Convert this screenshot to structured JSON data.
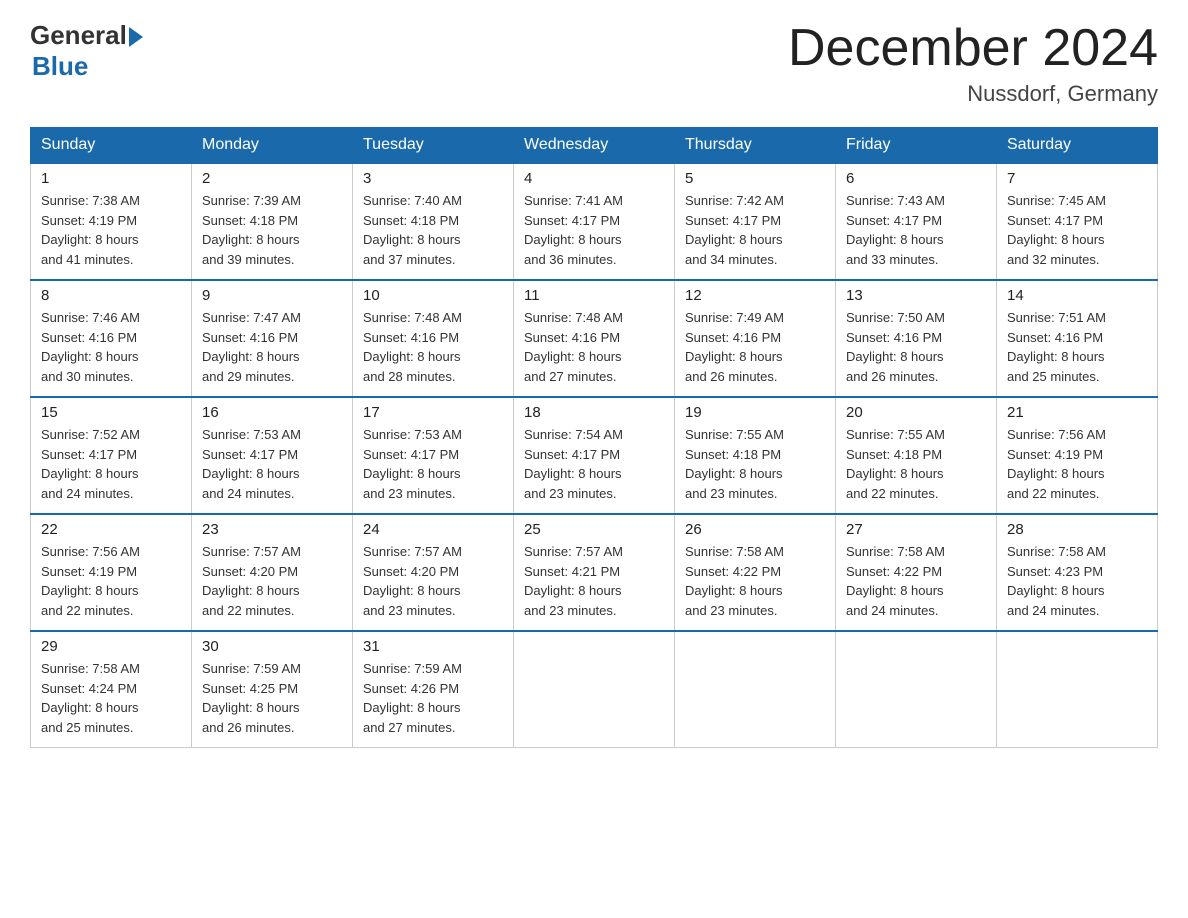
{
  "logo": {
    "general": "General",
    "blue": "Blue"
  },
  "title": {
    "month_year": "December 2024",
    "location": "Nussdorf, Germany"
  },
  "days_of_week": [
    "Sunday",
    "Monday",
    "Tuesday",
    "Wednesday",
    "Thursday",
    "Friday",
    "Saturday"
  ],
  "weeks": [
    [
      {
        "day": "1",
        "sunrise": "7:38 AM",
        "sunset": "4:19 PM",
        "daylight": "8 hours and 41 minutes."
      },
      {
        "day": "2",
        "sunrise": "7:39 AM",
        "sunset": "4:18 PM",
        "daylight": "8 hours and 39 minutes."
      },
      {
        "day": "3",
        "sunrise": "7:40 AM",
        "sunset": "4:18 PM",
        "daylight": "8 hours and 37 minutes."
      },
      {
        "day": "4",
        "sunrise": "7:41 AM",
        "sunset": "4:17 PM",
        "daylight": "8 hours and 36 minutes."
      },
      {
        "day": "5",
        "sunrise": "7:42 AM",
        "sunset": "4:17 PM",
        "daylight": "8 hours and 34 minutes."
      },
      {
        "day": "6",
        "sunrise": "7:43 AM",
        "sunset": "4:17 PM",
        "daylight": "8 hours and 33 minutes."
      },
      {
        "day": "7",
        "sunrise": "7:45 AM",
        "sunset": "4:17 PM",
        "daylight": "8 hours and 32 minutes."
      }
    ],
    [
      {
        "day": "8",
        "sunrise": "7:46 AM",
        "sunset": "4:16 PM",
        "daylight": "8 hours and 30 minutes."
      },
      {
        "day": "9",
        "sunrise": "7:47 AM",
        "sunset": "4:16 PM",
        "daylight": "8 hours and 29 minutes."
      },
      {
        "day": "10",
        "sunrise": "7:48 AM",
        "sunset": "4:16 PM",
        "daylight": "8 hours and 28 minutes."
      },
      {
        "day": "11",
        "sunrise": "7:48 AM",
        "sunset": "4:16 PM",
        "daylight": "8 hours and 27 minutes."
      },
      {
        "day": "12",
        "sunrise": "7:49 AM",
        "sunset": "4:16 PM",
        "daylight": "8 hours and 26 minutes."
      },
      {
        "day": "13",
        "sunrise": "7:50 AM",
        "sunset": "4:16 PM",
        "daylight": "8 hours and 26 minutes."
      },
      {
        "day": "14",
        "sunrise": "7:51 AM",
        "sunset": "4:16 PM",
        "daylight": "8 hours and 25 minutes."
      }
    ],
    [
      {
        "day": "15",
        "sunrise": "7:52 AM",
        "sunset": "4:17 PM",
        "daylight": "8 hours and 24 minutes."
      },
      {
        "day": "16",
        "sunrise": "7:53 AM",
        "sunset": "4:17 PM",
        "daylight": "8 hours and 24 minutes."
      },
      {
        "day": "17",
        "sunrise": "7:53 AM",
        "sunset": "4:17 PM",
        "daylight": "8 hours and 23 minutes."
      },
      {
        "day": "18",
        "sunrise": "7:54 AM",
        "sunset": "4:17 PM",
        "daylight": "8 hours and 23 minutes."
      },
      {
        "day": "19",
        "sunrise": "7:55 AM",
        "sunset": "4:18 PM",
        "daylight": "8 hours and 23 minutes."
      },
      {
        "day": "20",
        "sunrise": "7:55 AM",
        "sunset": "4:18 PM",
        "daylight": "8 hours and 22 minutes."
      },
      {
        "day": "21",
        "sunrise": "7:56 AM",
        "sunset": "4:19 PM",
        "daylight": "8 hours and 22 minutes."
      }
    ],
    [
      {
        "day": "22",
        "sunrise": "7:56 AM",
        "sunset": "4:19 PM",
        "daylight": "8 hours and 22 minutes."
      },
      {
        "day": "23",
        "sunrise": "7:57 AM",
        "sunset": "4:20 PM",
        "daylight": "8 hours and 22 minutes."
      },
      {
        "day": "24",
        "sunrise": "7:57 AM",
        "sunset": "4:20 PM",
        "daylight": "8 hours and 23 minutes."
      },
      {
        "day": "25",
        "sunrise": "7:57 AM",
        "sunset": "4:21 PM",
        "daylight": "8 hours and 23 minutes."
      },
      {
        "day": "26",
        "sunrise": "7:58 AM",
        "sunset": "4:22 PM",
        "daylight": "8 hours and 23 minutes."
      },
      {
        "day": "27",
        "sunrise": "7:58 AM",
        "sunset": "4:22 PM",
        "daylight": "8 hours and 24 minutes."
      },
      {
        "day": "28",
        "sunrise": "7:58 AM",
        "sunset": "4:23 PM",
        "daylight": "8 hours and 24 minutes."
      }
    ],
    [
      {
        "day": "29",
        "sunrise": "7:58 AM",
        "sunset": "4:24 PM",
        "daylight": "8 hours and 25 minutes."
      },
      {
        "day": "30",
        "sunrise": "7:59 AM",
        "sunset": "4:25 PM",
        "daylight": "8 hours and 26 minutes."
      },
      {
        "day": "31",
        "sunrise": "7:59 AM",
        "sunset": "4:26 PM",
        "daylight": "8 hours and 27 minutes."
      },
      null,
      null,
      null,
      null
    ]
  ],
  "labels": {
    "sunrise": "Sunrise:",
    "sunset": "Sunset:",
    "daylight": "Daylight:"
  }
}
